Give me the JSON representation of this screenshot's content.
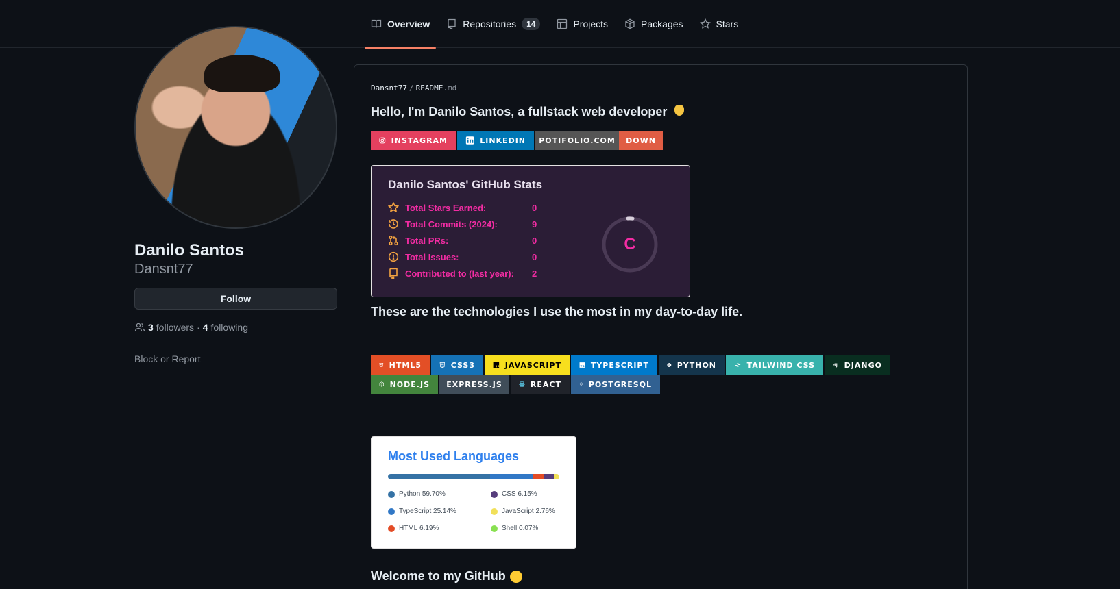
{
  "nav": {
    "tabs": [
      {
        "label": "Overview",
        "icon": "book-icon"
      },
      {
        "label": "Repositories",
        "icon": "repo-icon",
        "count": "14"
      },
      {
        "label": "Projects",
        "icon": "table-icon"
      },
      {
        "label": "Packages",
        "icon": "package-icon"
      },
      {
        "label": "Stars",
        "icon": "star-icon"
      }
    ],
    "active_tab": "Overview",
    "accent_color": "#f78166"
  },
  "profile": {
    "name": "Danilo Santos",
    "login": "Dansnt77",
    "follow_label": "Follow",
    "followers_count": "3",
    "followers_label": "followers",
    "dot": "·",
    "following_count": "4",
    "following_label": "following",
    "block_report": "Block or Report"
  },
  "readme": {
    "path_owner": "Dansnt77",
    "path_sep": "/",
    "path_file": "README",
    "path_ext": ".md",
    "hello": "Hello, I'm Danilo Santos, a fullstack web developer",
    "social_badges": [
      {
        "label": "INSTAGRAM",
        "color": "#e4405f",
        "icon": "instagram-icon"
      },
      {
        "label": "LINKEDIN",
        "color": "#0077b5",
        "icon": "linkedin-icon"
      },
      {
        "label": "POTIFOLIO.COM",
        "color": "#555555",
        "icon": ""
      },
      {
        "label": "DOWN",
        "color": "#e05d44",
        "icon": ""
      }
    ],
    "tech_intro": "These are the technologies I use the most in my day-to-day life.",
    "tech_badges": [
      {
        "label": "HTML5",
        "color": "#e34f26",
        "icon": "html5-icon"
      },
      {
        "label": "CSS3",
        "color": "#1572b6",
        "icon": "css3-icon"
      },
      {
        "label": "JAVASCRIPT",
        "color": "#f7df1e",
        "icon": "javascript-icon"
      },
      {
        "label": "TYPESCRIPT",
        "color": "#007acc",
        "icon": "typescript-icon"
      },
      {
        "label": "PYTHON",
        "color": "#14354c",
        "icon": "python-icon"
      },
      {
        "label": "TAILWIND CSS",
        "color": "#38b2ac",
        "icon": "tailwind-icon"
      },
      {
        "label": "DJANGO",
        "color": "#092e20",
        "icon": "django-icon"
      },
      {
        "label": "NODE.JS",
        "color": "#43853d",
        "icon": "nodejs-icon"
      },
      {
        "label": "EXPRESS.JS",
        "color": "#404d59",
        "icon": ""
      },
      {
        "label": "REACT",
        "color": "#20232a",
        "icon": "react-icon"
      },
      {
        "label": "POSTGRESQL",
        "color": "#316192",
        "icon": "postgresql-icon"
      }
    ],
    "welcome": "Welcome to my GitHub"
  },
  "stats_card": {
    "title": "Danilo Santos' GitHub Stats",
    "rows": [
      {
        "label": "Total Stars Earned:",
        "value": "0",
        "icon": "star-icon"
      },
      {
        "label": "Total Commits (2024):",
        "value": "9",
        "icon": "history-icon"
      },
      {
        "label": "Total PRs:",
        "value": "0",
        "icon": "pull-request-icon"
      },
      {
        "label": "Total Issues:",
        "value": "0",
        "icon": "issue-icon"
      },
      {
        "label": "Contributed to (last year):",
        "value": "2",
        "icon": "repo-icon"
      }
    ],
    "rank": "C",
    "colors": {
      "bg": "#2b1d36",
      "text": "#f22ca3",
      "icon": "#f2a241"
    }
  },
  "languages_card": {
    "title": "Most Used Languages",
    "languages": [
      {
        "name": "Python",
        "percent": "59.70%",
        "value": 59.7,
        "color": "#3572A5"
      },
      {
        "name": "TypeScript",
        "percent": "25.14%",
        "value": 25.14,
        "color": "#3178c6"
      },
      {
        "name": "HTML",
        "percent": "6.19%",
        "value": 6.19,
        "color": "#e34c26"
      },
      {
        "name": "CSS",
        "percent": "6.15%",
        "value": 6.15,
        "color": "#563d7c"
      },
      {
        "name": "JavaScript",
        "percent": "2.76%",
        "value": 2.76,
        "color": "#f1e05a"
      },
      {
        "name": "Shell",
        "percent": "0.07%",
        "value": 0.07,
        "color": "#89e051"
      }
    ]
  }
}
